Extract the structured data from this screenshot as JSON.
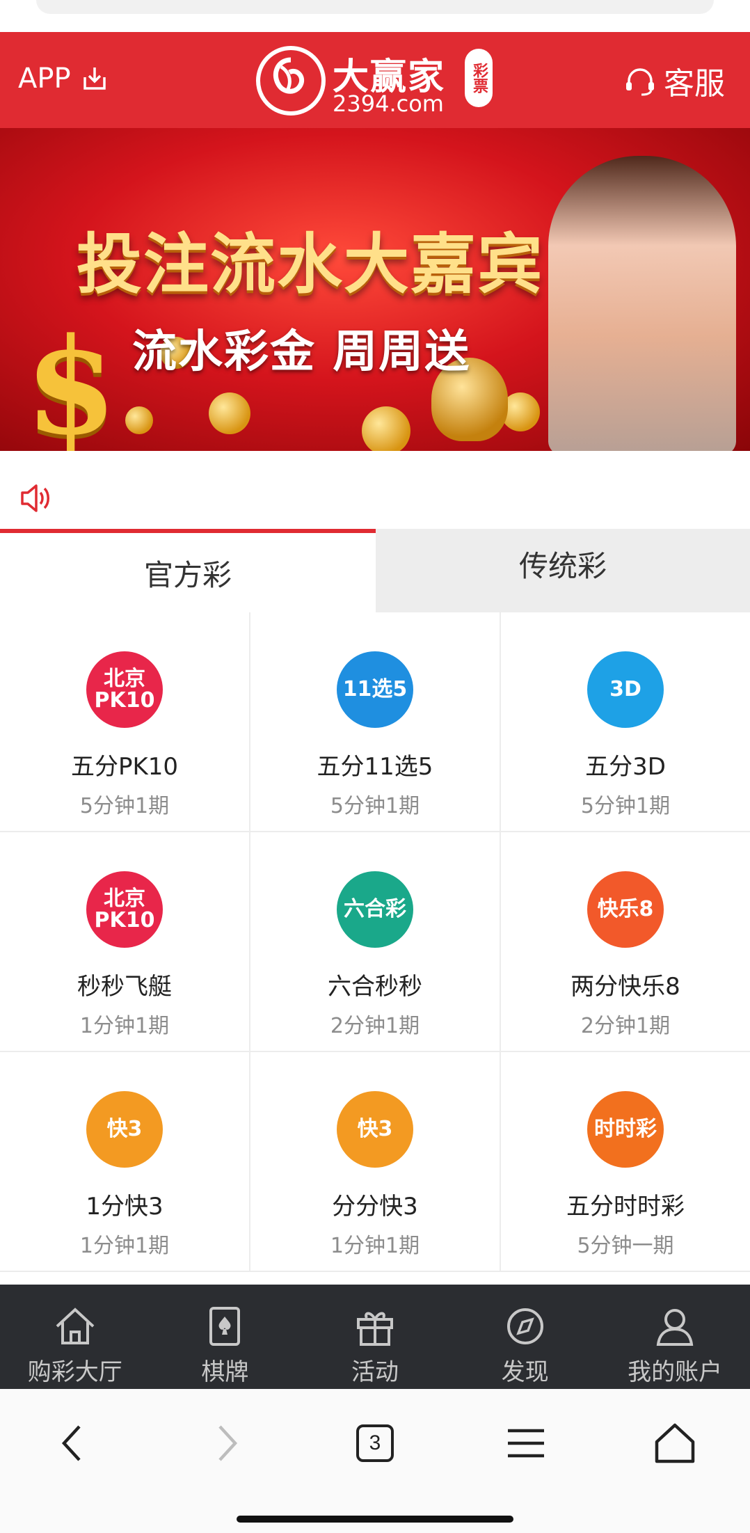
{
  "header": {
    "app_label": "APP",
    "logo_name": "大赢家",
    "logo_domain": "2394.com",
    "logo_seal": "彩票",
    "service_label": "客服"
  },
  "banner": {
    "title": "投注流水大嘉宾",
    "subtitle": "流水彩金 周周送"
  },
  "tabs": [
    {
      "label": "官方彩",
      "active": true
    },
    {
      "label": "传统彩",
      "active": false
    }
  ],
  "games": [
    {
      "name": "五分PK10",
      "period": "5分钟1期",
      "icon_text": "北京 PK10",
      "icon_color": "#e8264a"
    },
    {
      "name": "五分11选5",
      "period": "5分钟1期",
      "icon_text": "11选5",
      "icon_color": "#1f8fe0"
    },
    {
      "name": "五分3D",
      "period": "5分钟1期",
      "icon_text": "3D",
      "icon_color": "#1ea1e6"
    },
    {
      "name": "秒秒飞艇",
      "period": "1分钟1期",
      "icon_text": "北京 PK10",
      "icon_color": "#e8264a"
    },
    {
      "name": "六合秒秒",
      "period": "2分钟1期",
      "icon_text": "六合彩",
      "icon_color": "#1aa88a"
    },
    {
      "name": "两分快乐8",
      "period": "2分钟1期",
      "icon_text": "快乐8",
      "icon_color": "#f2592a"
    },
    {
      "name": "1分快3",
      "period": "1分钟1期",
      "icon_text": "快3",
      "icon_color": "#f39a22"
    },
    {
      "name": "分分快3",
      "period": "1分钟1期",
      "icon_text": "快3",
      "icon_color": "#f39a22"
    },
    {
      "name": "五分时时彩",
      "period": "5分钟一期",
      "icon_text": "时时彩",
      "icon_color": "#f2701e"
    }
  ],
  "tabbar": [
    {
      "label": "购彩大厅",
      "icon": "home-icon"
    },
    {
      "label": "棋牌",
      "icon": "cards-icon"
    },
    {
      "label": "活动",
      "icon": "gift-icon"
    },
    {
      "label": "发现",
      "icon": "compass-icon"
    },
    {
      "label": "我的账户",
      "icon": "user-icon"
    }
  ],
  "browser": {
    "tab_count": "3"
  },
  "colors": {
    "brand_red": "#e02b32",
    "tabbar_bg": "#2b2d31"
  }
}
